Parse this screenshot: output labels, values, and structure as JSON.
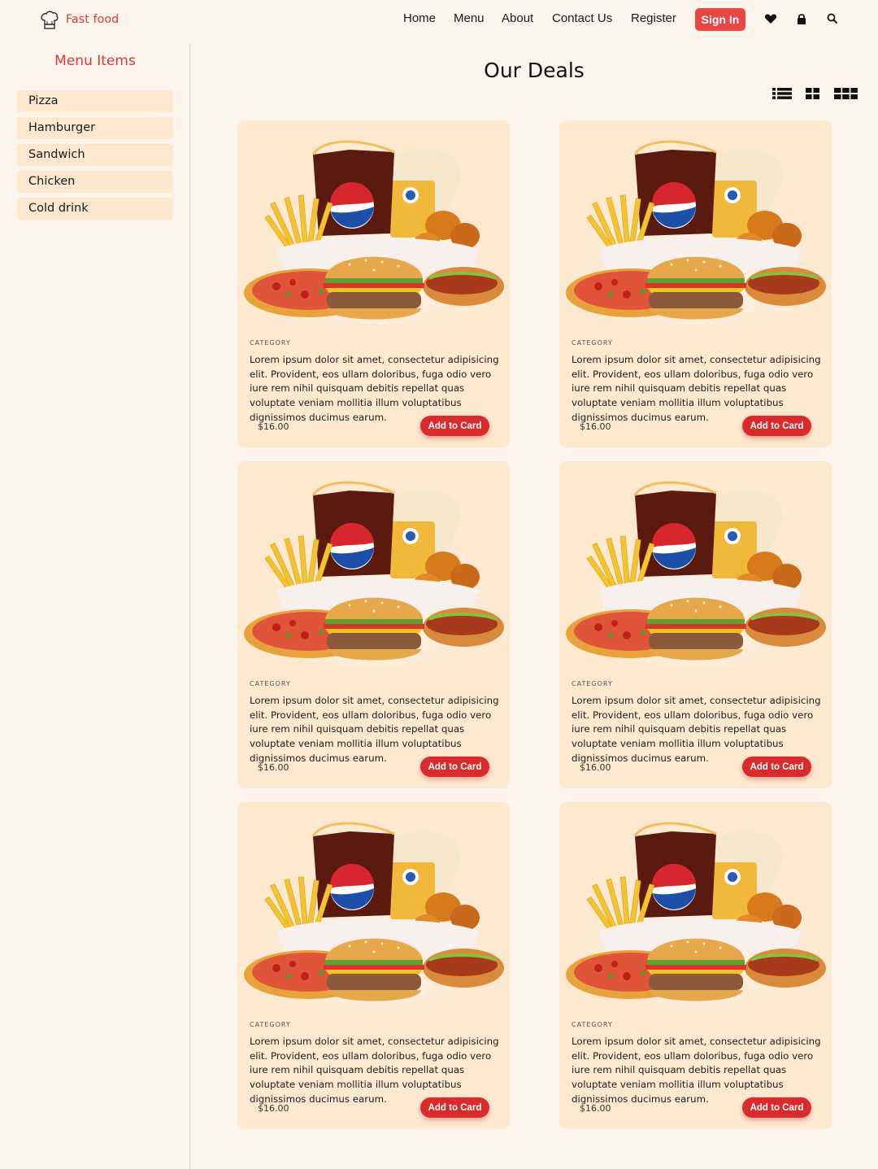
{
  "header": {
    "logo_text": "Fast food",
    "nav": [
      "Home",
      "Menu",
      "About",
      "Contact Us",
      "Register"
    ],
    "signin_label": "Sign In",
    "icons": [
      "heart-icon",
      "lock-icon",
      "search-icon"
    ]
  },
  "sidebar": {
    "title": "Menu Items",
    "items": [
      "Pizza",
      "Hamburger",
      "Sandwich",
      "Chicken",
      "Cold drink"
    ]
  },
  "main": {
    "title": "Our Deals",
    "view_icons": [
      "list-view-icon",
      "grid-2-icon",
      "grid-3-icon"
    ],
    "cards": [
      {
        "category": "CATEGORY",
        "description": "Lorem ipsum dolor sit amet, consectetur adipisicing elit. Provident, eos ullam doloribus, fuga odio vero iure rem nihil quisquam debitis repellat quas voluptate veniam mollitia illum voluptatibus dignissimos ducimus earum.",
        "price": "$16.00",
        "button": "Add to Card"
      },
      {
        "category": "CATEGORY",
        "description": "Lorem ipsum dolor sit amet, consectetur adipisicing elit. Provident, eos ullam doloribus, fuga odio vero iure rem nihil quisquam debitis repellat quas voluptate veniam mollitia illum voluptatibus dignissimos ducimus earum.",
        "price": "$16.00",
        "button": "Add to Card"
      },
      {
        "category": "CATEGORY",
        "description": "Lorem ipsum dolor sit amet, consectetur adipisicing elit. Provident, eos ullam doloribus, fuga odio vero iure rem nihil quisquam debitis repellat quas voluptate veniam mollitia illum voluptatibus dignissimos ducimus earum.",
        "price": "$16.00",
        "button": "Add to Card"
      },
      {
        "category": "CATEGORY",
        "description": "Lorem ipsum dolor sit amet, consectetur adipisicing elit. Provident, eos ullam doloribus, fuga odio vero iure rem nihil quisquam debitis repellat quas voluptate veniam mollitia illum voluptatibus dignissimos ducimus earum.",
        "price": "$16.00",
        "button": "Add to Card"
      },
      {
        "category": "CATEGORY",
        "description": "Lorem ipsum dolor sit amet, consectetur adipisicing elit. Provident, eos ullam doloribus, fuga odio vero iure rem nihil quisquam debitis repellat quas voluptate veniam mollitia illum voluptatibus dignissimos ducimus earum.",
        "price": "$16.00",
        "button": "Add to Card"
      },
      {
        "category": "CATEGORY",
        "description": "Lorem ipsum dolor sit amet, consectetur adipisicing elit. Provident, eos ullam doloribus, fuga odio vero iure rem nihil quisquam debitis repellat quas voluptate veniam mollitia illum voluptatibus dignissimos ducimus earum.",
        "price": "$16.00",
        "button": "Add to Card"
      }
    ]
  },
  "colors": {
    "background": "#fdf4ec",
    "card": "#fde8d0",
    "accent": "#d92b2b",
    "sidebar_item": "#fde7cf"
  }
}
